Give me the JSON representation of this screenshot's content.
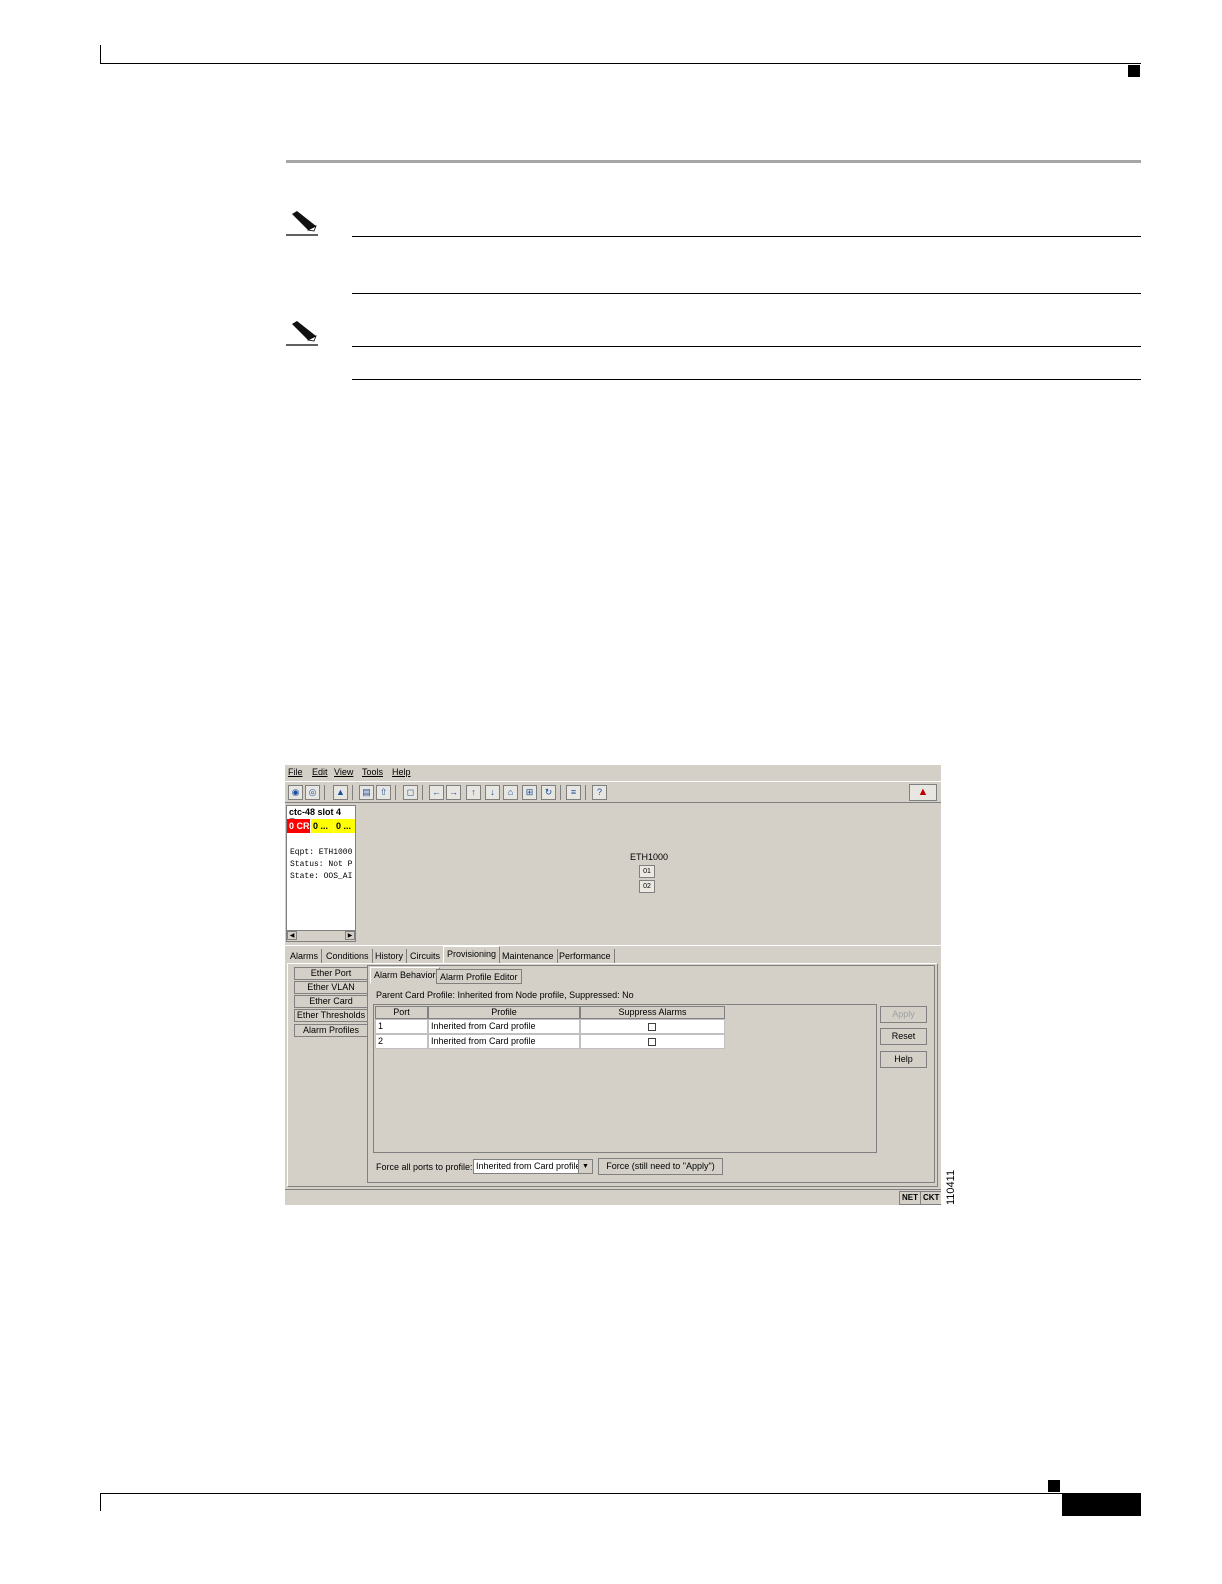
{
  "window": {
    "menu": [
      "File",
      "Edit",
      "View",
      "Tools",
      "Help"
    ],
    "toolbar_icons": [
      "globe-icon",
      "network-icon",
      "lock-icon",
      "print-icon",
      "export-icon",
      "properties-icon",
      "back-arrow-icon",
      "forward-arrow-icon",
      "up-arrow-icon",
      "down-arrow-icon",
      "home-icon",
      "zoom-icon",
      "refresh-icon",
      "span-icon",
      "help-icon"
    ],
    "node_panel": {
      "title": "ctc-48 slot 4 E...",
      "badges": [
        {
          "text": "0 CR",
          "color": "#ff0000"
        },
        {
          "text": "0 ...",
          "color": "#ffff00"
        },
        {
          "text": "0 ...",
          "color": "#ffff00"
        }
      ],
      "lines": [
        "Eqpt: ETH1000",
        "Status: Not P",
        "State: OOS_AI"
      ]
    },
    "card": {
      "label": "ETH1000",
      "ports": [
        "01",
        "02"
      ]
    },
    "tabs": [
      "Alarms",
      "Conditions",
      "History",
      "Circuits",
      "Provisioning",
      "Maintenance",
      "Performance"
    ],
    "active_tab": "Provisioning",
    "side_buttons": [
      "Ether Port",
      "Ether VLAN",
      "Ether Card",
      "Ether Thresholds",
      "Alarm Profiles"
    ],
    "sub_tabs": [
      "Alarm Behavior",
      "Alarm Profile Editor"
    ],
    "parent_profile": "Parent Card Profile: Inherited from Node profile, Suppressed: No",
    "table": {
      "headers": [
        "Port",
        "Profile",
        "Suppress Alarms"
      ],
      "rows": [
        {
          "port": "1",
          "profile": "Inherited from Card profile",
          "suppress": false
        },
        {
          "port": "2",
          "profile": "Inherited from Card profile",
          "suppress": false
        }
      ]
    },
    "buttons": {
      "apply": "Apply",
      "reset": "Reset",
      "help": "Help"
    },
    "force": {
      "label": "Force all ports to profile:",
      "selected": "Inherited from Card profile",
      "button": "Force (still need to \"Apply\")"
    },
    "status": [
      "NET",
      "CKT"
    ]
  },
  "figure_number": "110411"
}
